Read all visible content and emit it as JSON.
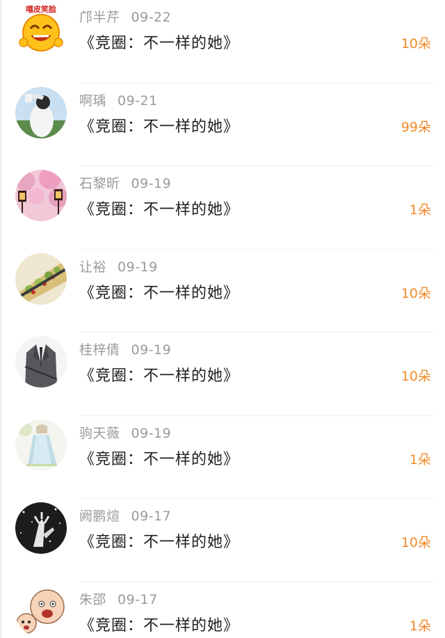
{
  "gift_list": {
    "items": [
      {
        "name": "邝半芹",
        "date": "09-22",
        "title": "《竞圈：不一样的她》",
        "count": "10朵",
        "avatar": "emoji-grin-sticker-avatar",
        "avatar_text": "嘻皮笑脸"
      },
      {
        "name": "啊瑀",
        "date": "09-21",
        "title": "《竞圈：不一样的她》",
        "count": "99朵",
        "avatar": "photo-girl-sky-avatar"
      },
      {
        "name": "石黎昕",
        "date": "09-19",
        "title": "《竞圈：不一样的她》",
        "count": "1朵",
        "avatar": "photo-cherry-blossom-lamp-avatar"
      },
      {
        "name": "让裕",
        "date": "09-19",
        "title": "《竞圈：不一样的她》",
        "count": "10朵",
        "avatar": "photo-food-avatar"
      },
      {
        "name": "桂梓倩",
        "date": "09-19",
        "title": "《竞圈：不一样的她》",
        "count": "10朵",
        "avatar": "photo-suit-avatar"
      },
      {
        "name": "驹天薇",
        "date": "09-19",
        "title": "《竞圈：不一样的她》",
        "count": "1朵",
        "avatar": "illustration-girl-dress-avatar"
      },
      {
        "name": "阙鹏煊",
        "date": "09-17",
        "title": "《竞圈：不一样的她》",
        "count": "10朵",
        "avatar": "photo-dark-hands-avatar"
      },
      {
        "name": "朱邵",
        "date": "09-17",
        "title": "《竞圈：不一样的她》",
        "count": "1朵",
        "avatar": "cartoon-bald-faces-avatar"
      }
    ]
  },
  "colors": {
    "name_gray": "#9a9a9a",
    "title_black": "#1e1e1e",
    "count_orange": "#f08a2a",
    "divider": "#f0f0f0"
  }
}
